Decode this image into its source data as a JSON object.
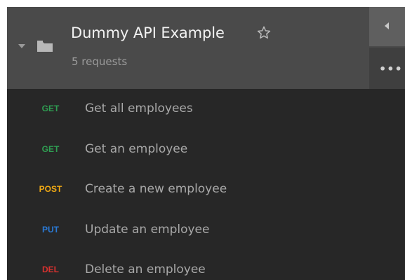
{
  "colors": {
    "header_bg": "#4a4a4a",
    "list_bg": "#272727",
    "get": "#2f9e52",
    "post": "#f0a914",
    "put": "#2a7ad6",
    "del": "#d8322f"
  },
  "collection": {
    "title": "Dummy API Example",
    "subtitle": "5 requests"
  },
  "requests": [
    {
      "method": "GET",
      "name": "Get all employees",
      "color": "#2f9e52"
    },
    {
      "method": "GET",
      "name": "Get an employee",
      "color": "#2f9e52"
    },
    {
      "method": "POST",
      "name": "Create a new employee",
      "color": "#f0a914"
    },
    {
      "method": "PUT",
      "name": "Update an employee",
      "color": "#2a7ad6"
    },
    {
      "method": "DEL",
      "name": "Delete an employee",
      "color": "#d8322f"
    }
  ],
  "icons": {
    "collapse": "caret-down-icon",
    "folder": "folder-icon",
    "favorite": "star-outline-icon",
    "sidebar": "triangle-left-icon",
    "more": "ellipsis-icon"
  }
}
